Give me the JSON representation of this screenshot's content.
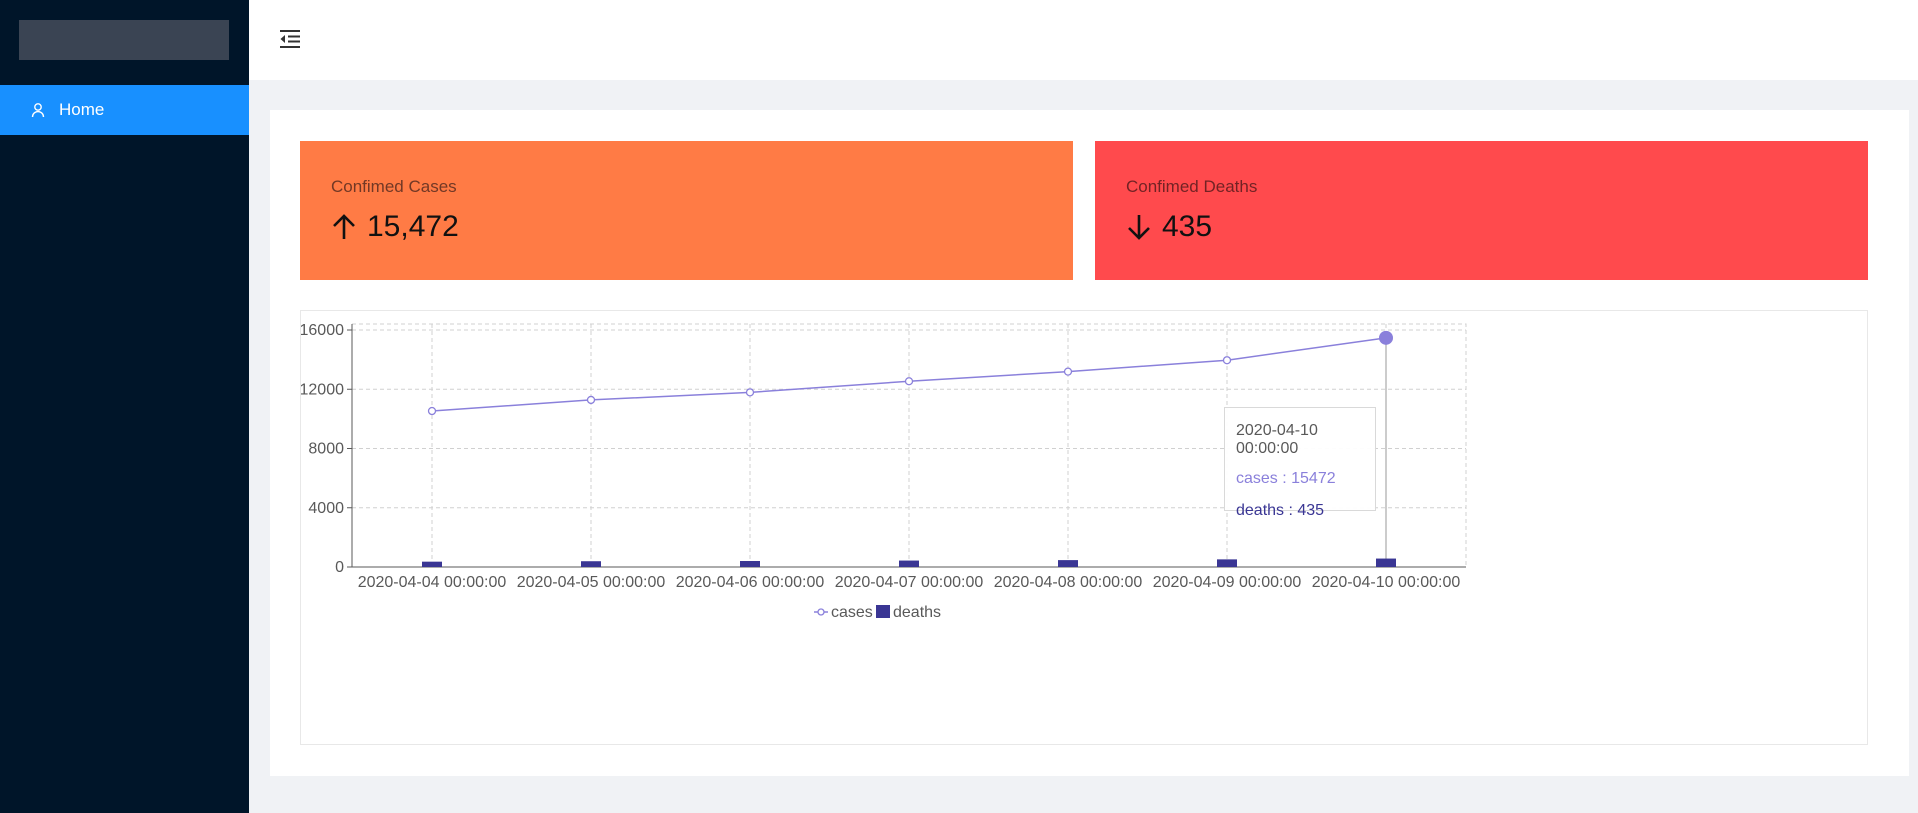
{
  "sidebar": {
    "menu": [
      {
        "label": "Home",
        "icon": "user-icon",
        "active": true
      }
    ]
  },
  "header": {
    "toggle_icon": "menu-fold-icon"
  },
  "cards": {
    "cases": {
      "title": "Confimed Cases",
      "value": "15,472",
      "icon": "arrow-up-icon",
      "color": "#ff7b45"
    },
    "deaths": {
      "title": "Confimed Deaths",
      "value": "435",
      "icon": "arrow-down-icon",
      "color": "#ff4a4d"
    }
  },
  "chart_data": {
    "type": "line",
    "categories": [
      "2020-04-04 00:00:00",
      "2020-04-05 00:00:00",
      "2020-04-06 00:00:00",
      "2020-04-07 00:00:00",
      "2020-04-08 00:00:00",
      "2020-04-09 00:00:00",
      "2020-04-10 00:00:00"
    ],
    "series": [
      {
        "name": "cases",
        "type": "line",
        "color": "#8a80db",
        "values": [
          10530,
          11280,
          11790,
          12540,
          13190,
          13960,
          15472
        ]
      },
      {
        "name": "deaths",
        "type": "bar",
        "color": "#3a3694",
        "values": [
          225,
          255,
          270,
          300,
          330,
          380,
          435
        ]
      }
    ],
    "ylim": [
      0,
      16000
    ],
    "yticks": [
      0,
      4000,
      8000,
      12000,
      16000
    ],
    "grid": true,
    "legend": "bottom",
    "highlight_index": 6,
    "tooltip": {
      "title": "2020-04-10 00:00:00",
      "cases": "cases : 15472",
      "deaths": "deaths : 435"
    }
  }
}
